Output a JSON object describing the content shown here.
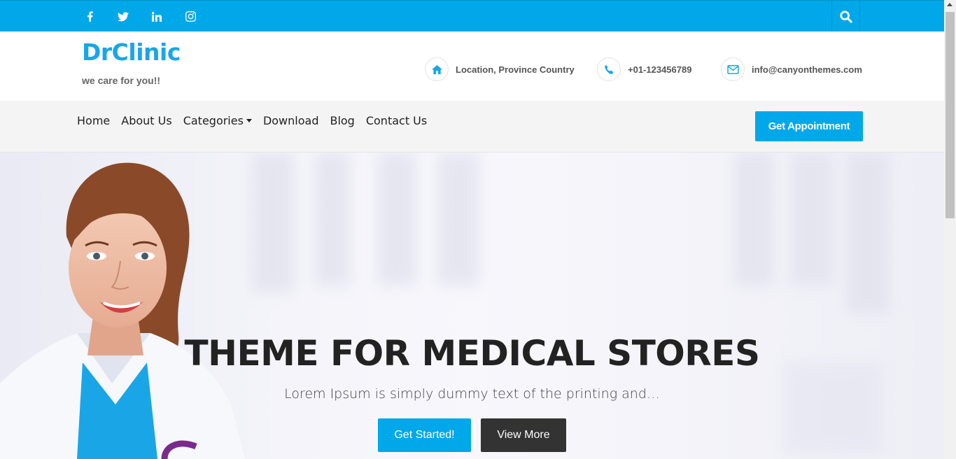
{
  "topbar": {
    "social": [
      "facebook-icon",
      "twitter-icon",
      "linkedin-icon",
      "instagram-icon"
    ],
    "search_icon": "search-icon",
    "color": "#00a8ea"
  },
  "header": {
    "logo": "DrClinic",
    "tagline": "we care for you!!",
    "contacts": [
      {
        "icon": "home-icon",
        "text": "Location, Province Country"
      },
      {
        "icon": "phone-icon",
        "text": "+01-123456789"
      },
      {
        "icon": "envelope-icon",
        "text": "info@canyonthemes.com"
      }
    ]
  },
  "nav": {
    "items": [
      "Home",
      "About Us",
      "Categories",
      "Download",
      "Blog",
      "Contact Us"
    ],
    "appointment_label": "Get Appointment"
  },
  "hero": {
    "title": "THEME FOR MEDICAL STORES",
    "subtitle": "Lorem Ipsum is simply dummy text of the printing and…",
    "primary_button": "Get Started!",
    "secondary_button": "View More"
  }
}
